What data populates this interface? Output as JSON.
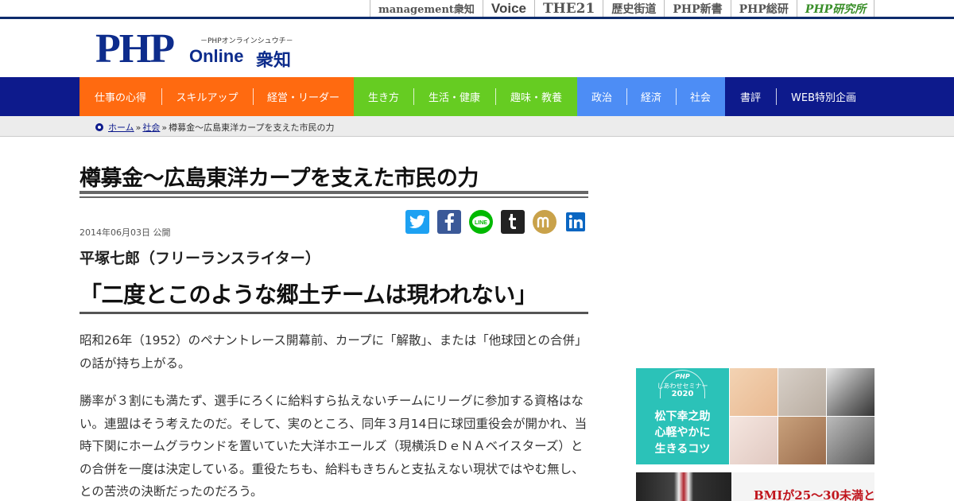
{
  "top_links": [
    {
      "label": "management衆知"
    },
    {
      "label": "Voice"
    },
    {
      "label": "THE21"
    },
    {
      "label": "歴史街道"
    },
    {
      "label": "PHP新書"
    },
    {
      "label": "PHP総研"
    },
    {
      "label": "PHP研究所"
    }
  ],
  "logo": {
    "php": "PHP",
    "kana": "－PHPオンラインシュウチ－",
    "online": "Online",
    "shuchi": "衆知"
  },
  "nav": {
    "orange": [
      "仕事の心得",
      "スキルアップ",
      "経営・リーダー"
    ],
    "green": [
      "生き方",
      "生活・健康",
      "趣味・教養"
    ],
    "blue": [
      "政治",
      "経済",
      "社会"
    ],
    "navy": [
      "書評",
      "WEB特別企画"
    ]
  },
  "breadcrumb": {
    "home": "ホーム",
    "category": "社会",
    "current": "樽募金～広島東洋カープを支えた市民の力",
    "sep": "»"
  },
  "article": {
    "title": "樽募金～広島東洋カープを支えた市民の力",
    "date": "2014年06月03日 公開",
    "author": "平塚七郎（フリーランスライター）",
    "subtitle": "「二度とこのような郷土チームは現われない」",
    "paragraphs": [
      "昭和26年（1952）のペナントレース開幕前、カープに「解散」、または「他球団との合併」の話が持ち上がる。",
      "勝率が３割にも満たず、選手にろくに給料すら払えないチームにリーグに参加する資格はない。連盟はそう考えたのだ。そして、実のところ、同年３月14日に球団重役会が開かれ、当時下関にホームグラウンドを置いていた大洋ホエールズ（現横浜ＤｅＮＡベイスターズ）との合併を一度は決定している。重役たちも、給料もきちんと支払えない現状ではやむ無し、との苦渋の決断だったのだろう。"
    ]
  },
  "share_icons": [
    "twitter-icon",
    "facebook-icon",
    "line-icon",
    "tumblr-icon",
    "mixi-icon",
    "linkedin-icon"
  ],
  "ad1": {
    "brand": "PHP",
    "seminar": "しあわせセミナー",
    "year": "2020",
    "line1": "松下幸之助",
    "line2": "心軽やかに",
    "line3": "生きるコツ"
  },
  "ad2": {
    "text": "BMIが25～30未満と"
  },
  "colors": {
    "navy": "#0d1a8c",
    "orange": "#ff6a10",
    "green": "#66cc22",
    "blue": "#4d8df5",
    "teal": "#2bc2b8"
  }
}
